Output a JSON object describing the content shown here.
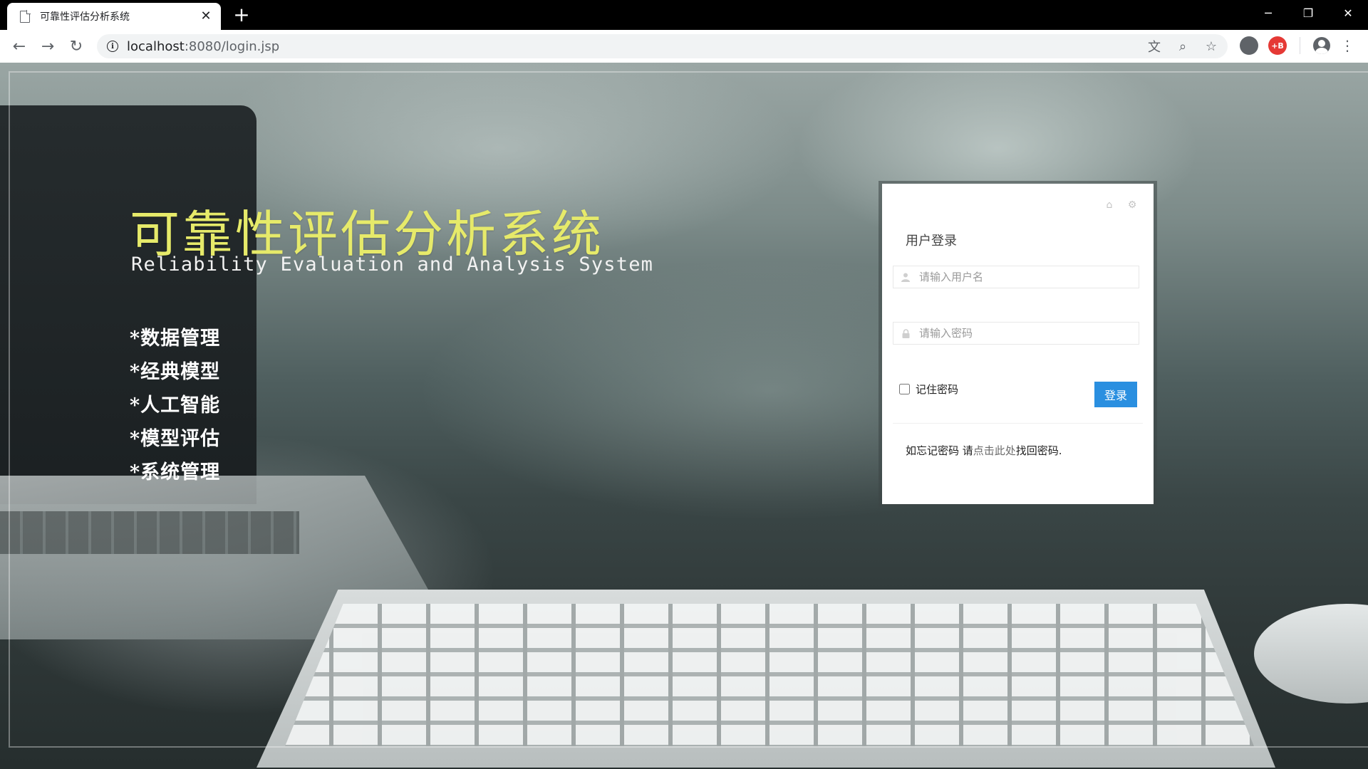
{
  "browser": {
    "tab_title": "可靠性评估分析系统",
    "tab_close": "✕",
    "new_tab": "+",
    "url_host": "localhost",
    "url_path": ":8080/login.jsp",
    "window_controls": {
      "minimize": "─",
      "restore": "❐",
      "close": "✕"
    },
    "icons": {
      "back": "←",
      "forward": "→",
      "reload": "↻",
      "translate": "文",
      "zoom": "⌕",
      "bookmark": "☆",
      "menu": "⋮"
    },
    "extensions": [
      {
        "name": "extension-icon",
        "label": "",
        "color": "#5f6368"
      },
      {
        "name": "extension-red-icon",
        "label": "+B",
        "color": "#e53935"
      }
    ]
  },
  "page": {
    "system_title": "可靠性评估分析系统",
    "system_subtitle": "Reliability Evaluation and Analysis System",
    "features": [
      "*数据管理",
      "*经典模型",
      "*人工智能",
      "*模型评估",
      "*系统管理"
    ]
  },
  "login": {
    "title": "用户登录",
    "home_icon": "⌂",
    "settings_icon": "⚙",
    "username_placeholder": "请输入用户名",
    "password_placeholder": "请输入密码",
    "remember_label": "记住密码",
    "submit_label": "登录",
    "forgot_prefix": "如忘记密码 请",
    "forgot_link": "点击此处",
    "forgot_suffix": "找回密码."
  },
  "colors": {
    "title_yellow": "#e6ea6a",
    "button_blue": "#2a8fe0"
  }
}
